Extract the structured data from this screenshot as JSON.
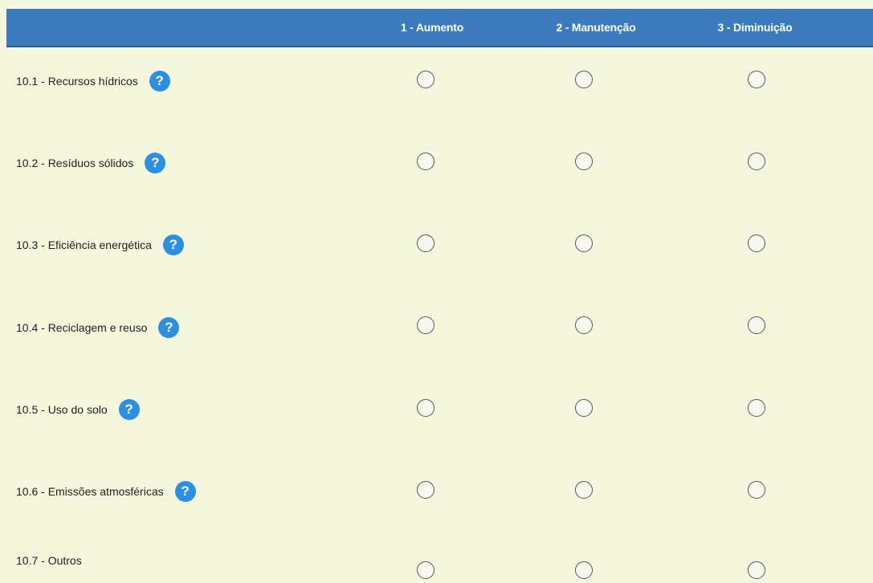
{
  "columns": [
    "1 - Aumento",
    "2 - Manutenção",
    "3 - Diminuição"
  ],
  "rows": [
    {
      "label": "10.1 - Recursos hídricos",
      "has_help": true
    },
    {
      "label": "10.2 - Resíduos sólidos",
      "has_help": true
    },
    {
      "label": "10.3 - Eficiência energética",
      "has_help": true
    },
    {
      "label": "10.4 - Reciclagem e reuso",
      "has_help": true
    },
    {
      "label": "10.5 - Uso do solo",
      "has_help": true
    },
    {
      "label": "10.6 - Emissões atmosféricas",
      "has_help": true
    },
    {
      "label": "10.7 - Outros",
      "has_help": false
    }
  ],
  "help_icon_glyph": "?",
  "colors": {
    "header_bg": "#3b7bbd",
    "page_bg": "#f5f7dc",
    "help_icon": "#2b8fe3"
  }
}
